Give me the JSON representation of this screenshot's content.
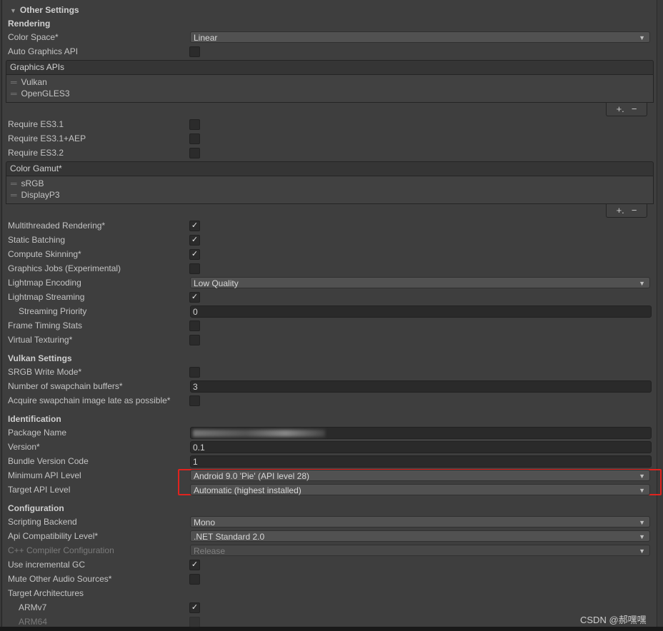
{
  "section_title": "Other Settings",
  "rows": [
    {
      "kind": "bold",
      "label": "Rendering"
    },
    {
      "kind": "dropdown",
      "label": "Color Space*",
      "value": "Linear"
    },
    {
      "kind": "checkbox",
      "label": "Auto Graphics API",
      "checked": false
    },
    {
      "kind": "list",
      "label": "Graphics APIs",
      "items": [
        "Vulkan",
        "OpenGLES3"
      ],
      "add": "+.",
      "remove": "−"
    },
    {
      "kind": "checkbox",
      "label": "Require ES3.1",
      "checked": false
    },
    {
      "kind": "checkbox",
      "label": "Require ES3.1+AEP",
      "checked": false
    },
    {
      "kind": "checkbox",
      "label": "Require ES3.2",
      "checked": false
    },
    {
      "kind": "list",
      "label": "Color Gamut*",
      "items": [
        "sRGB",
        "DisplayP3"
      ],
      "add": "+.",
      "remove": "−"
    },
    {
      "kind": "checkbox",
      "label": "Multithreaded Rendering*",
      "checked": true
    },
    {
      "kind": "checkbox",
      "label": "Static Batching",
      "checked": true
    },
    {
      "kind": "checkbox",
      "label": "Compute Skinning*",
      "checked": true
    },
    {
      "kind": "checkbox",
      "label": "Graphics Jobs (Experimental)",
      "checked": false
    },
    {
      "kind": "dropdown",
      "label": "Lightmap Encoding",
      "value": "Low Quality"
    },
    {
      "kind": "checkbox",
      "label": "Lightmap Streaming",
      "checked": true
    },
    {
      "kind": "text",
      "label": "Streaming Priority",
      "value": "0",
      "indent": true
    },
    {
      "kind": "checkbox",
      "label": "Frame Timing Stats",
      "checked": false
    },
    {
      "kind": "checkbox",
      "label": "Virtual Texturing*",
      "checked": false
    },
    {
      "kind": "bold",
      "label": "Vulkan Settings"
    },
    {
      "kind": "checkbox",
      "label": "SRGB Write Mode*",
      "checked": false
    },
    {
      "kind": "text",
      "label": "Number of swapchain buffers*",
      "value": "3"
    },
    {
      "kind": "checkbox",
      "label": "Acquire swapchain image late as possible*",
      "checked": false
    },
    {
      "kind": "bold",
      "label": "Identification"
    },
    {
      "kind": "text",
      "label": "Package Name",
      "value": "",
      "blurred": true
    },
    {
      "kind": "text",
      "label": "Version*",
      "value": "0.1"
    },
    {
      "kind": "text",
      "label": "Bundle Version Code",
      "value": "1"
    },
    {
      "kind": "dropdown",
      "label": "Minimum API Level",
      "value": "Android 9.0 'Pie' (API level 28)"
    },
    {
      "kind": "dropdown",
      "label": "Target API Level",
      "value": "Automatic (highest installed)"
    },
    {
      "kind": "bold",
      "label": "Configuration"
    },
    {
      "kind": "dropdown",
      "label": "Scripting Backend",
      "value": "Mono"
    },
    {
      "kind": "dropdown",
      "label": "Api Compatibility Level*",
      "value": ".NET Standard 2.0"
    },
    {
      "kind": "dropdown",
      "label": "C++ Compiler Configuration",
      "value": "Release",
      "disabled": true
    },
    {
      "kind": "checkbox",
      "label": "Use incremental GC",
      "checked": true
    },
    {
      "kind": "checkbox",
      "label": "Mute Other Audio Sources*",
      "checked": false
    },
    {
      "kind": "plain",
      "label": "Target Architectures"
    },
    {
      "kind": "checkbox",
      "label": "ARMv7",
      "checked": true,
      "indent": true
    },
    {
      "kind": "checkbox",
      "label": "ARM64",
      "checked": false,
      "indent": true,
      "disabled": true
    }
  ],
  "highlight_color": "#e0231e",
  "watermark": "CSDN @郝嘿嘿"
}
